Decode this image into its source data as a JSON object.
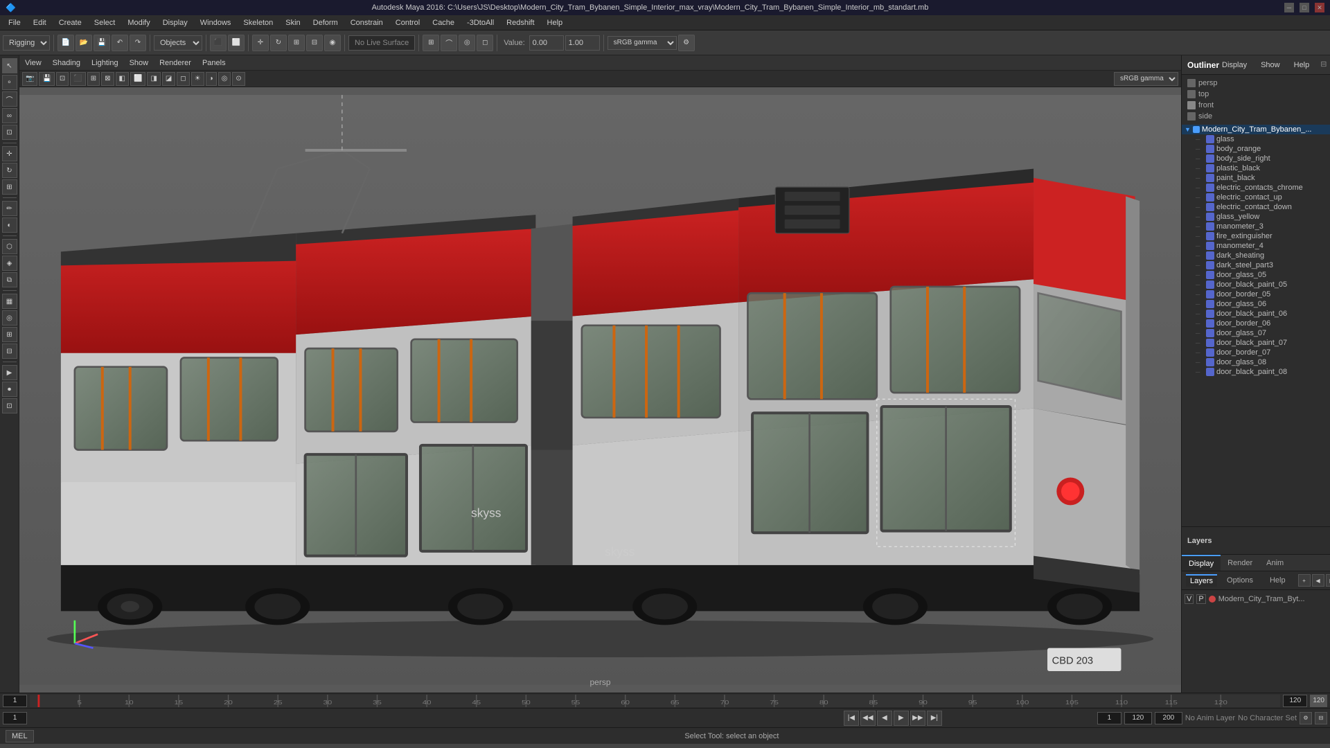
{
  "titleBar": {
    "title": "Autodesk Maya 2016: C:\\Users\\JS\\Desktop\\Modern_City_Tram_Bybanen_Simple_Interior_max_vray\\Modern_City_Tram_Bybanen_Simple_Interior_mb_standart.mb",
    "minimize": "─",
    "maximize": "□",
    "close": "✕"
  },
  "menuBar": {
    "items": [
      "File",
      "Edit",
      "Create",
      "Select",
      "Modify",
      "Display",
      "Windows",
      "Skeleton",
      "Skin",
      "Deform",
      "Constrain",
      "Control",
      "Cache",
      "-3DtoAll",
      "Redshift",
      "Help"
    ]
  },
  "toolbar": {
    "rigging": "Rigging",
    "objects": "Objects",
    "liveSurface": "No Live Surface",
    "valueField": "0.00",
    "scaleField": "1.00",
    "gamma": "sRGB gamma"
  },
  "viewportMenus": {
    "items": [
      "View",
      "Shading",
      "Lighting",
      "Show",
      "Renderer",
      "Panels"
    ]
  },
  "viewport": {
    "label": "persp",
    "coords": ""
  },
  "outliner": {
    "title": "Outliner",
    "tabs": [
      "Display",
      "Show",
      "Help"
    ],
    "cameras": [
      {
        "name": "persp",
        "active": false
      },
      {
        "name": "top",
        "active": false
      },
      {
        "name": "front",
        "active": true
      },
      {
        "name": "side",
        "active": false
      }
    ],
    "objects": [
      {
        "name": "Modern_City_Tram_Bybanen_...",
        "level": 0,
        "expanded": true,
        "color": "#4a9eff"
      },
      {
        "name": "glass",
        "level": 1,
        "color": "#a0a0ff"
      },
      {
        "name": "body_orange",
        "level": 1,
        "color": "#a0a0ff"
      },
      {
        "name": "body_side_right",
        "level": 1,
        "color": "#a0a0ff"
      },
      {
        "name": "plastic_black",
        "level": 1,
        "color": "#a0a0ff"
      },
      {
        "name": "paint_black",
        "level": 1,
        "color": "#a0a0ff"
      },
      {
        "name": "electric_contacts_chrome",
        "level": 1,
        "color": "#a0a0ff"
      },
      {
        "name": "electric_contact_up",
        "level": 1,
        "color": "#a0a0ff"
      },
      {
        "name": "electric_contact_down",
        "level": 1,
        "color": "#a0a0ff"
      },
      {
        "name": "glass_yellow",
        "level": 1,
        "color": "#a0a0ff"
      },
      {
        "name": "manometer_3",
        "level": 1,
        "color": "#a0a0ff"
      },
      {
        "name": "fire_extinguisher",
        "level": 1,
        "color": "#a0a0ff"
      },
      {
        "name": "manometer_4",
        "level": 1,
        "color": "#a0a0ff"
      },
      {
        "name": "dark_sheating",
        "level": 1,
        "color": "#a0a0ff"
      },
      {
        "name": "dark_steel_part3",
        "level": 1,
        "color": "#a0a0ff"
      },
      {
        "name": "door_glass_05",
        "level": 1,
        "color": "#a0a0ff"
      },
      {
        "name": "door_black_paint_05",
        "level": 1,
        "color": "#a0a0ff"
      },
      {
        "name": "door_border_05",
        "level": 1,
        "color": "#a0a0ff"
      },
      {
        "name": "door_glass_06",
        "level": 1,
        "color": "#a0a0ff"
      },
      {
        "name": "door_black_paint_06",
        "level": 1,
        "color": "#a0a0ff"
      },
      {
        "name": "door_border_06",
        "level": 1,
        "color": "#a0a0ff"
      },
      {
        "name": "door_glass_07",
        "level": 1,
        "color": "#a0a0ff"
      },
      {
        "name": "door_black_paint_07",
        "level": 1,
        "color": "#a0a0ff"
      },
      {
        "name": "door_border_07",
        "level": 1,
        "color": "#a0a0ff"
      },
      {
        "name": "door_glass_08",
        "level": 1,
        "color": "#a0a0ff"
      },
      {
        "name": "door_black_paint_08",
        "level": 1,
        "color": "#a0a0ff"
      }
    ]
  },
  "bottomPanel": {
    "tabs": [
      "Display",
      "Render",
      "Anim"
    ],
    "activeTab": "Display",
    "secondTabs": [
      "Layers",
      "Options",
      "Help"
    ],
    "vp": "V",
    "p": "P",
    "objectName": "Modern_City_Tram_Byt...",
    "dotColor": "#cc4444"
  },
  "animBar": {
    "frameStart": "1",
    "frameCurrent": "1",
    "frameEnd": "120",
    "rangeStart": "1",
    "rangeEnd": "120",
    "rangeMax": "200",
    "noAnimLayer": "No Anim Layer",
    "noCharacterSet": "No Character Set"
  },
  "statusBar": {
    "mel": "MEL",
    "statusText": "Select Tool: select an object"
  },
  "timeline": {
    "marks": [
      5,
      10,
      15,
      20,
      25,
      30,
      35,
      40,
      45,
      50,
      55,
      60,
      65,
      70,
      75,
      80,
      85,
      90,
      95,
      100,
      105,
      110,
      115,
      120,
      1
    ]
  }
}
